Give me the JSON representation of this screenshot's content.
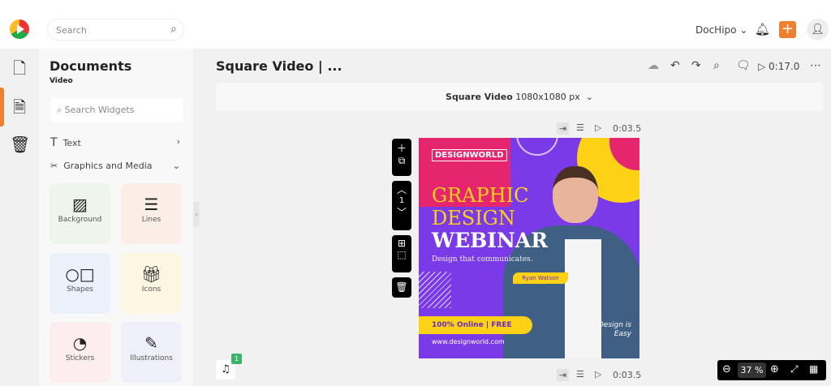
{
  "topbar": {
    "search_placeholder": "Search",
    "account": "DocHipo",
    "account_chevron": "⌄"
  },
  "sidebar": {
    "title": "Documents",
    "subtitle": "Video",
    "widget_search_placeholder": "Search Widgets",
    "sections": [
      {
        "label": "Text",
        "chevron": "›"
      },
      {
        "label": "Graphics and Media",
        "chevron": "⌄"
      }
    ],
    "tiles": [
      {
        "label": "Background",
        "icon": "background-icon",
        "color": "#eef6ec"
      },
      {
        "label": "Lines",
        "icon": "lines-icon",
        "color": "#fbeee6"
      },
      {
        "label": "Shapes",
        "icon": "shapes-icon",
        "color": "#eaf1fa"
      },
      {
        "label": "Icons",
        "icon": "gift-icon",
        "color": "#fdf6e3"
      },
      {
        "label": "Stickers",
        "icon": "sticker-icon",
        "color": "#fceeee"
      },
      {
        "label": "Illustrations",
        "icon": "illustration-icon",
        "color": "#efeff9"
      }
    ]
  },
  "editor": {
    "doc_title": "Square Video | ...",
    "duration": "0:17.0",
    "size_name": "Square Video",
    "size_dims": "1080x1080 px",
    "page_time": "0:03.5",
    "page_number": "1",
    "next_page_time": "0:03.5",
    "zoom_value": "37",
    "zoom_unit": "%",
    "audio_count": "1"
  },
  "design": {
    "brand": "DESIGNWORLD",
    "line1": "GRAPHIC",
    "line2": "DESIGN",
    "line3": "WEBINAR",
    "tagline": "Design that communicates.",
    "name": "Ryan Watson",
    "banner_a": "100% Online",
    "banner_sep": "|",
    "banner_b": "FREE",
    "website": "www.designworld.com",
    "quote1": "Design is",
    "quote2": "Easy",
    "colors": {
      "purple": "#7b3ae8",
      "pink": "#e6256f",
      "yellow": "#fcd116"
    }
  },
  "colors": {
    "accent": "#f07f2f"
  }
}
